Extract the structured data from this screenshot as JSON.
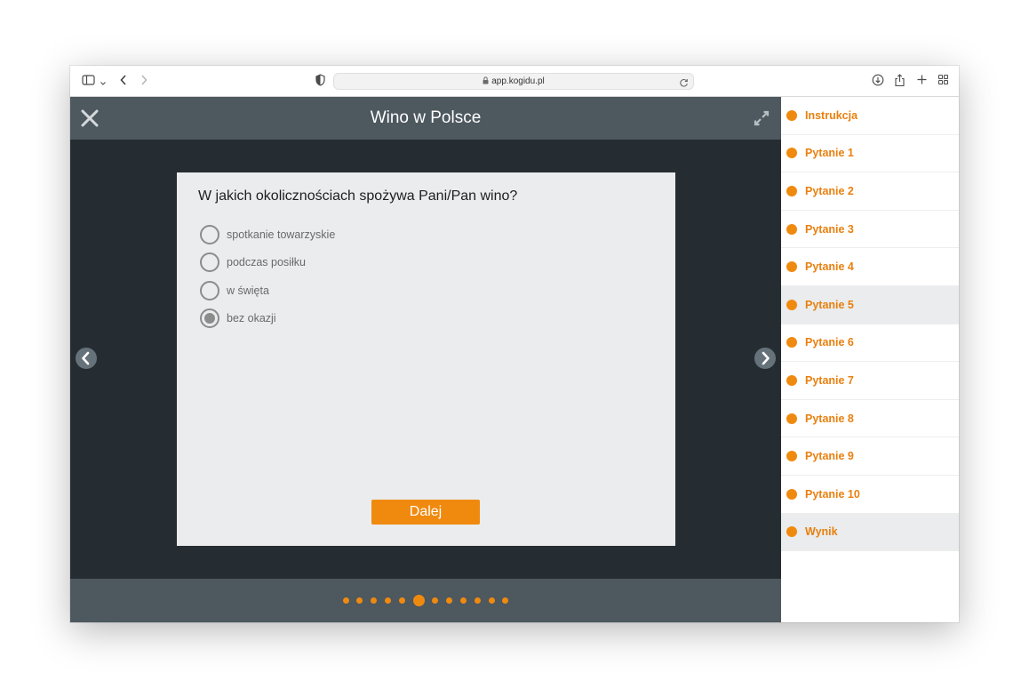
{
  "browser": {
    "url": "app.kogidu.pl"
  },
  "app": {
    "title": "Wino w Polsce"
  },
  "question": {
    "text": "W jakich okolicznościach spożywa Pani/Pan wino?",
    "options": [
      {
        "label": "spotkanie towarzyskie",
        "selected": false
      },
      {
        "label": "podczas posiłku",
        "selected": false
      },
      {
        "label": "w święta",
        "selected": false
      },
      {
        "label": "bez okazji",
        "selected": true
      }
    ],
    "next_label": "Dalej"
  },
  "progress": {
    "total_steps": 12,
    "current_step": 6
  },
  "sidebar": {
    "items": [
      {
        "label": "Instrukcja",
        "highlighted": false
      },
      {
        "label": "Pytanie 1",
        "highlighted": false
      },
      {
        "label": "Pytanie 2",
        "highlighted": false
      },
      {
        "label": "Pytanie 3",
        "highlighted": false
      },
      {
        "label": "Pytanie 4",
        "highlighted": false
      },
      {
        "label": "Pytanie 5",
        "highlighted": true
      },
      {
        "label": "Pytanie 6",
        "highlighted": false
      },
      {
        "label": "Pytanie 7",
        "highlighted": false
      },
      {
        "label": "Pytanie 8",
        "highlighted": false
      },
      {
        "label": "Pytanie 9",
        "highlighted": false
      },
      {
        "label": "Pytanie 10",
        "highlighted": false
      },
      {
        "label": "Wynik",
        "highlighted": true
      }
    ]
  },
  "colors": {
    "accent": "#f08a0f",
    "header": "#4d585f",
    "stage": "#262d32",
    "card": "#eaeced"
  },
  "icons": [
    "sidebar-toggle-icon",
    "chevron-down-icon",
    "back-icon",
    "forward-icon",
    "shield-icon",
    "lock-icon",
    "reload-icon",
    "download-icon",
    "share-icon",
    "new-tab-icon",
    "tab-overview-icon",
    "close-icon",
    "expand-icon",
    "chevron-left-icon",
    "chevron-right-icon"
  ]
}
